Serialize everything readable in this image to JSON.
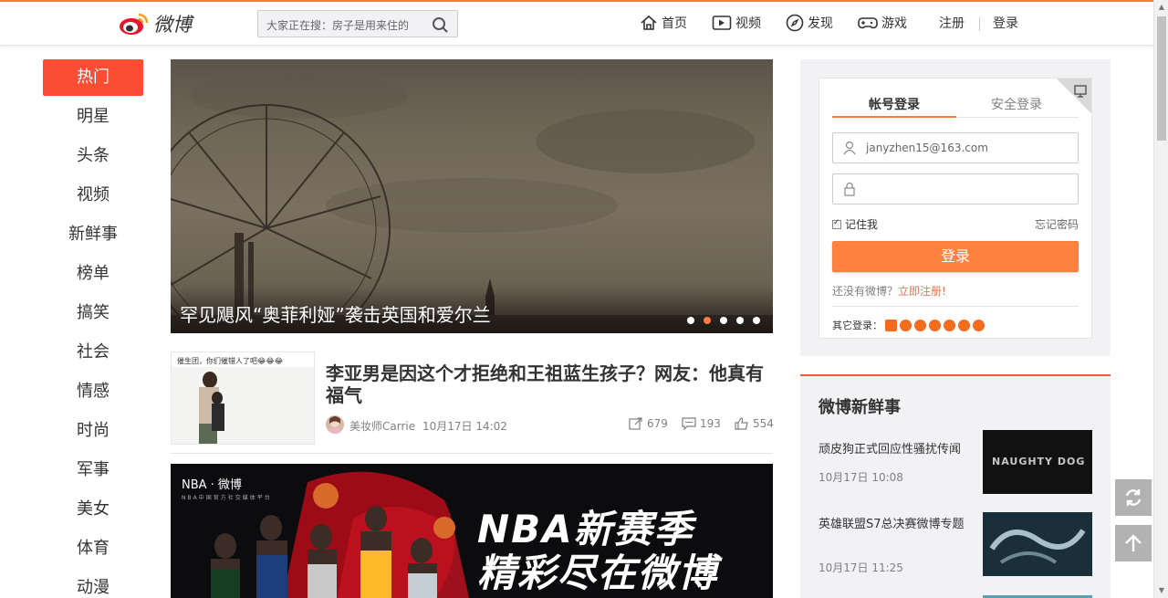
{
  "header": {
    "logo_text": "微博",
    "search_placeholder": "大家正在搜：房子是用来住的",
    "nav": [
      {
        "label": "首页",
        "icon": "home-icon"
      },
      {
        "label": "视频",
        "icon": "video-icon"
      },
      {
        "label": "发现",
        "icon": "compass-icon"
      },
      {
        "label": "游戏",
        "icon": "gamepad-icon"
      }
    ],
    "register": "注册",
    "login": "登录"
  },
  "sidebar": {
    "items": [
      "热门",
      "明星",
      "头条",
      "视频",
      "新鲜事",
      "榜单",
      "搞笑",
      "社会",
      "情感",
      "时尚",
      "军事",
      "美女",
      "体育",
      "动漫"
    ],
    "active_index": 0
  },
  "hero": {
    "caption": "罕见飓风“奥菲利娅”袭击英国和爱尔兰",
    "slide_count": 5,
    "active_slide": 2
  },
  "feed_item": {
    "thumb_caption": "催生团，你们催错人了吧😂😂😂",
    "title": "李亚男是因这个才拒绝和王祖蓝生孩子？网友：他真有福气",
    "author": "美妆师Carrie",
    "time": "10月17日 14:02",
    "reposts": "679",
    "comments": "193",
    "likes": "554"
  },
  "banner": {
    "brand": "NBA · 微博",
    "brand_sub": "NBA中国官方社交媒体平台",
    "line1": "NBA新赛季",
    "line2": "精彩尽在微博"
  },
  "login_box": {
    "tab_account": "帐号登录",
    "tab_secure": "安全登录",
    "username_value": "janyzhen15@163.com",
    "remember_label": "记住我",
    "forgot_label": "忘记密码",
    "login_button": "登录",
    "no_account": "还没有微博？",
    "register_now": "立即注册!",
    "other_login": "其它登录：",
    "accent": "#ff8140"
  },
  "fresh": {
    "title": "微博新鲜事",
    "items": [
      {
        "title": "顽皮狗正式回应性骚扰传闻",
        "time": "10月17日 10:08",
        "image_text": "NAUGHTY DOG"
      },
      {
        "title": "英雄联盟S7总决赛微博专题",
        "time": "10月17日 11:25"
      }
    ]
  },
  "floating": {
    "refresh_icon": "refresh-icon",
    "top_icon": "arrow-up-icon"
  }
}
